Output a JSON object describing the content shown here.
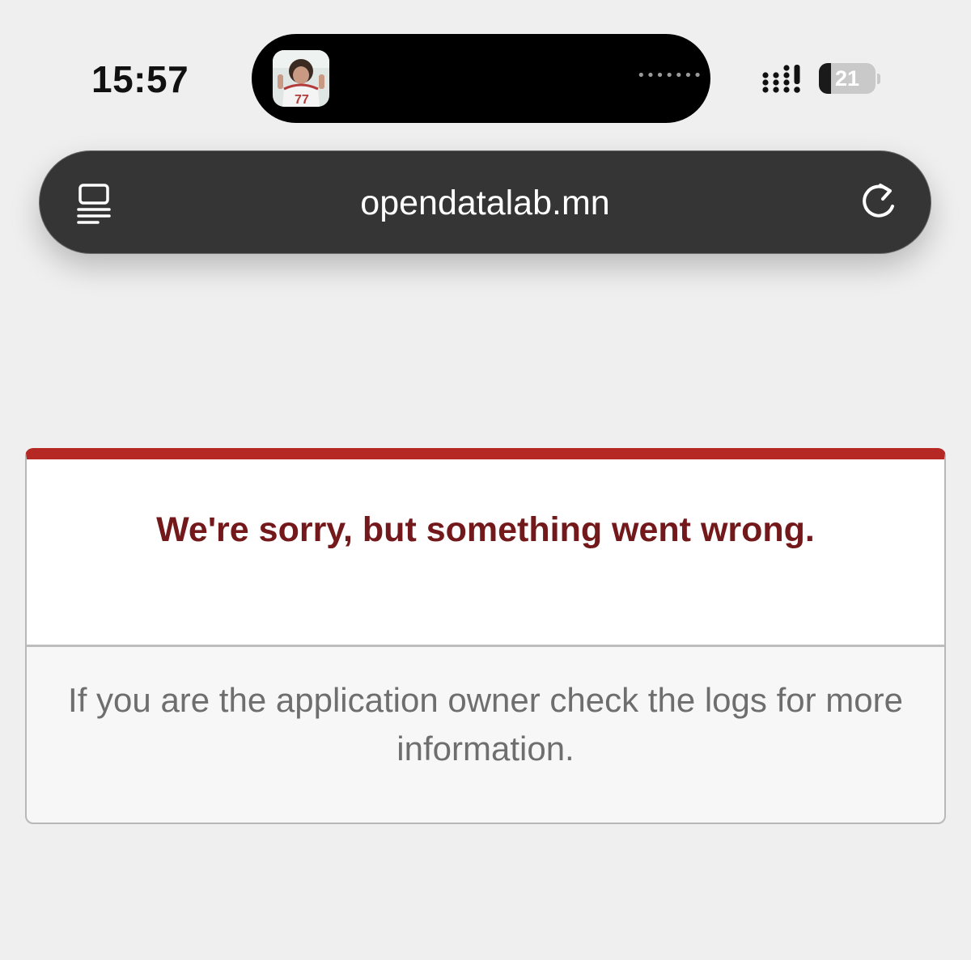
{
  "status_bar": {
    "time": "15:57",
    "island_more": "•••••••",
    "battery_level": "21",
    "battery_percent": 21
  },
  "address_bar": {
    "url": "opendatalab.mn",
    "tabs_icon": "tabs-icon",
    "reload_icon": "reload-icon"
  },
  "error": {
    "title": "We're sorry, but something went wrong.",
    "message": "If you are the application owner check the logs for more information."
  },
  "colors": {
    "page_background": "#efefef",
    "address_bar": "#353535",
    "error_accent": "#b52824",
    "error_title": "#73191b",
    "error_text": "#6e6e6e"
  }
}
